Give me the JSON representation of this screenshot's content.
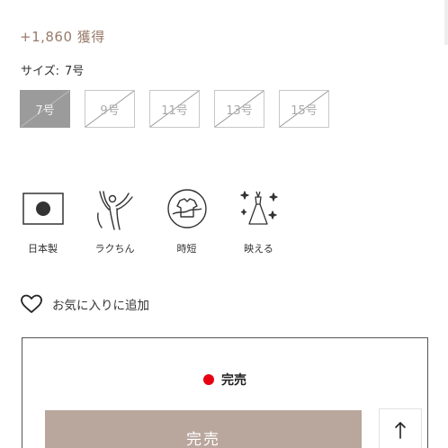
{
  "points": {
    "text": "+1,860 獲得"
  },
  "size": {
    "label": "サイズ:",
    "selected": "7号",
    "options": [
      {
        "label": "7号",
        "selected": true,
        "available": false
      },
      {
        "label": "9号",
        "selected": false,
        "available": false
      },
      {
        "label": "11号",
        "selected": false,
        "available": false
      },
      {
        "label": "13号",
        "selected": false,
        "available": false
      },
      {
        "label": "15号",
        "selected": false,
        "available": false
      }
    ]
  },
  "features": [
    {
      "icon": "japan-flag-icon",
      "label": "日本製"
    },
    {
      "icon": "stretch-person-icon",
      "label": "ラクちん"
    },
    {
      "icon": "time-saving-shirt-icon",
      "label": "時短"
    },
    {
      "icon": "sparkle-dress-icon",
      "label": "映える"
    }
  ],
  "favorite": {
    "icon": "heart-icon",
    "label": "お気に入りに追加"
  },
  "stock": {
    "status": "完売",
    "status_color": "#e60012",
    "button_label": "完売"
  },
  "scroll_top": {
    "icon": "arrow-up-icon",
    "label": "↑"
  },
  "colors": {
    "accent": "#9a7b6a",
    "button": "#b9a69c",
    "selected_size": "#9b9b9b"
  }
}
